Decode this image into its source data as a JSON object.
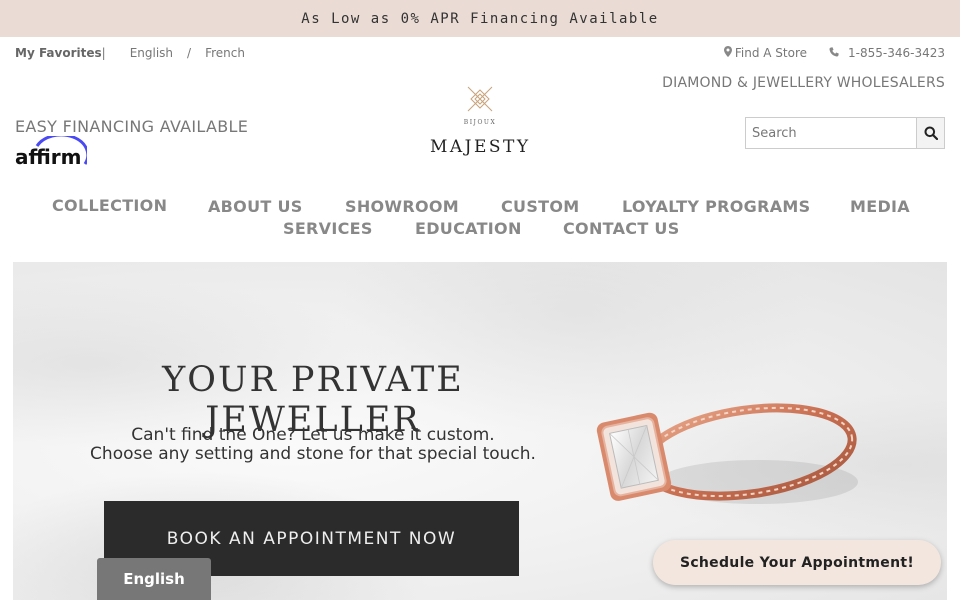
{
  "promo": {
    "text": "As Low as 0% APR Financing Available"
  },
  "utility": {
    "favorites": "My Favorites",
    "separator": "|",
    "lang_english": "English",
    "lang_slash": "/",
    "lang_french": "French",
    "find_store": "Find A Store",
    "phone": "1-855-346-3423"
  },
  "header": {
    "wholesalers": "DIAMOND & JEWELLERY WHOLESALERS",
    "financing": "EASY FINANCING AVAILABLE",
    "affirm_logo_text": "affirm",
    "logo": {
      "small": "BIJOUX",
      "name": "MAJESTY"
    },
    "search": {
      "placeholder": "Search"
    }
  },
  "nav": {
    "items": [
      {
        "label": "COLLECTION"
      },
      {
        "label": "ABOUT US"
      },
      {
        "label": "SHOWROOM"
      },
      {
        "label": "CUSTOM"
      },
      {
        "label": "LOYALTY PROGRAMS"
      },
      {
        "label": "MEDIA"
      },
      {
        "label": "SERVICES"
      },
      {
        "label": "EDUCATION"
      },
      {
        "label": "CONTACT US"
      }
    ]
  },
  "hero": {
    "title": "YOUR PRIVATE JEWELLER",
    "subtitle_line1": "Can't find the One? Let us make it custom.",
    "subtitle_line2": "Choose any setting and stone for that special touch.",
    "cta": "BOOK AN APPOINTMENT NOW"
  },
  "widgets": {
    "language": "English",
    "schedule": "Schedule Your Appointment!"
  },
  "colors": {
    "promo_bg": "#eadcd4",
    "cta_bg": "#2b2b2b",
    "schedule_bg": "#f3e6de",
    "affirm_blue": "#4a4af4",
    "rose_gold": "#d9876a"
  }
}
